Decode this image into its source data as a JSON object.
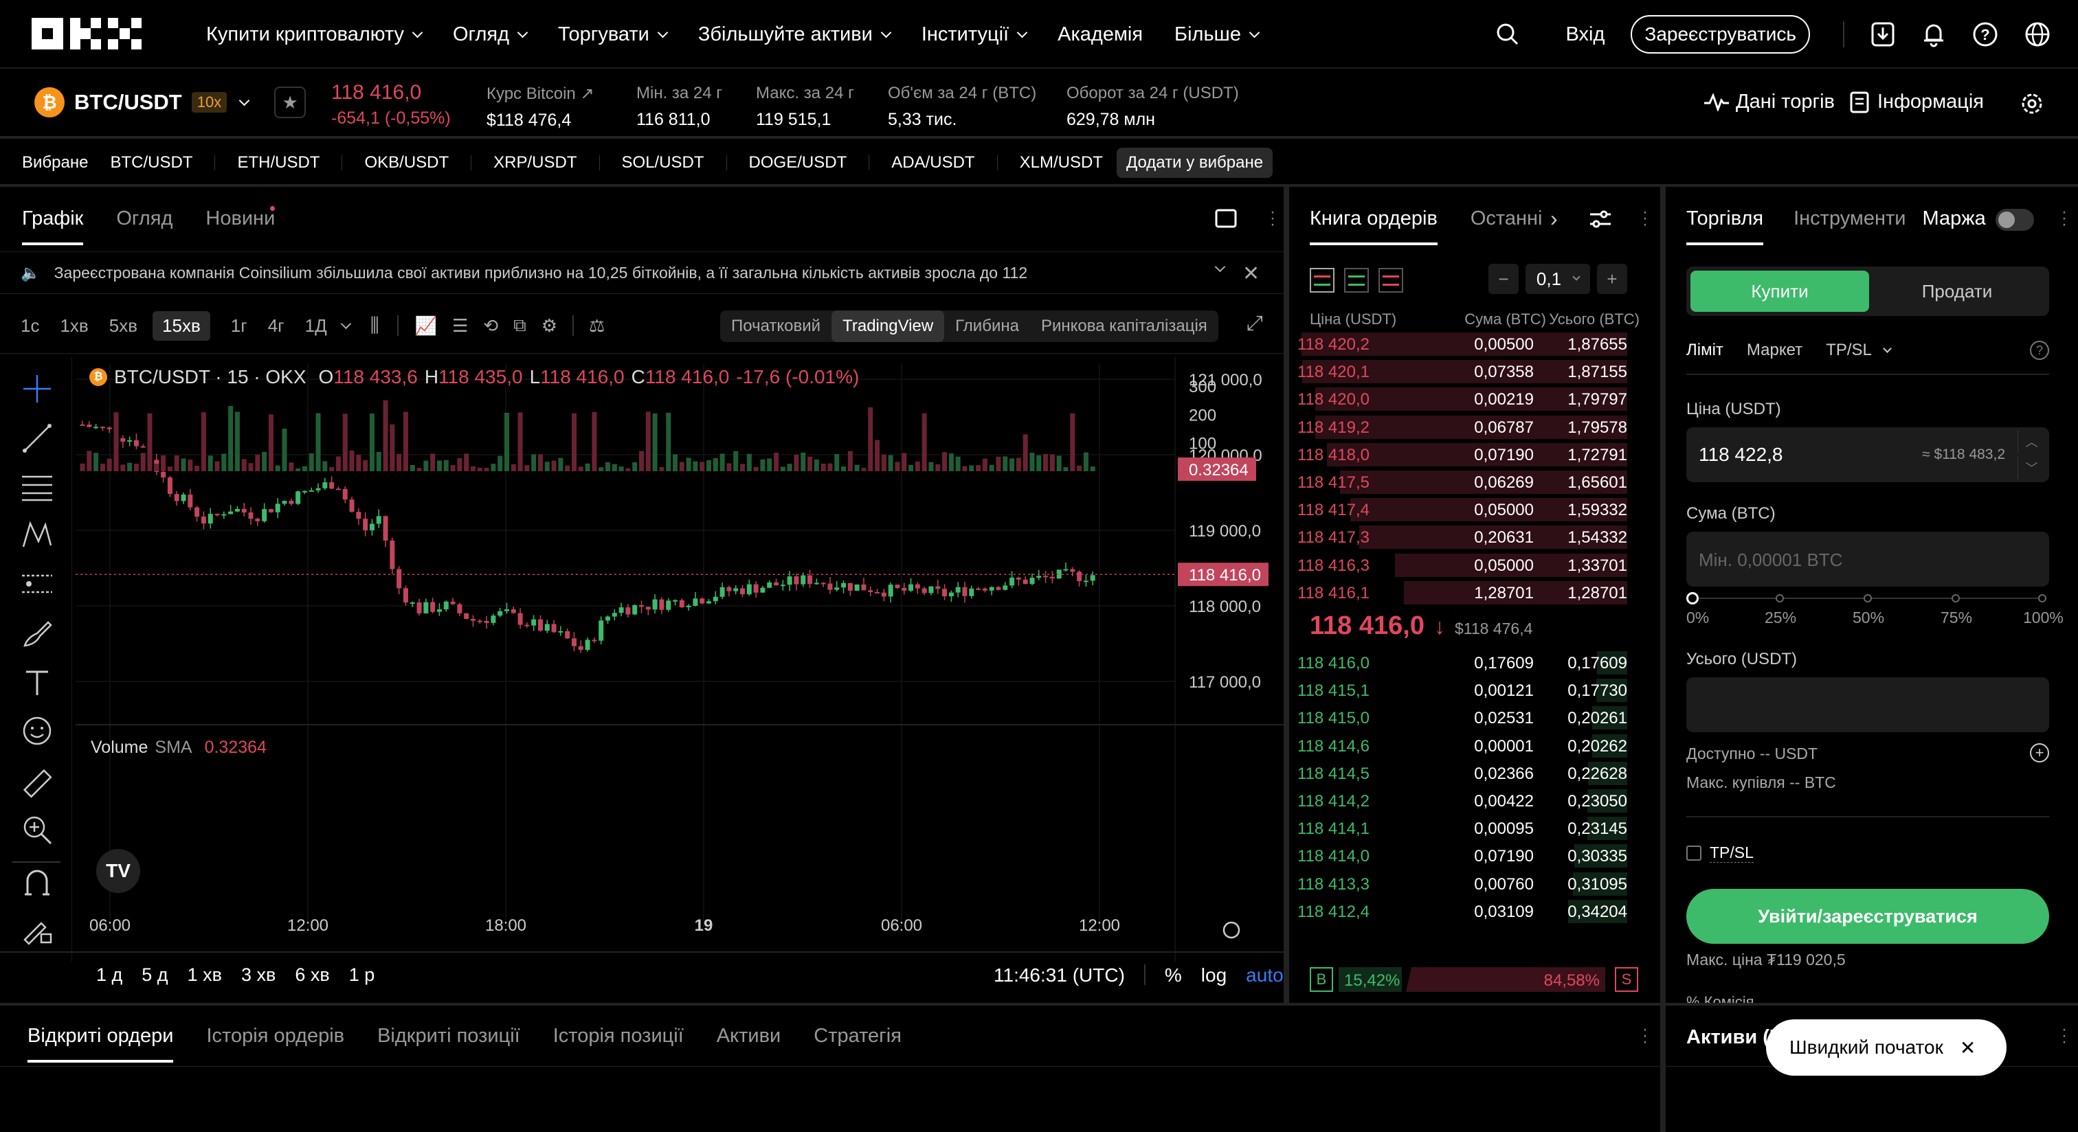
{
  "nav": {
    "logo": "OKX",
    "items": [
      "Купити криптовалюту",
      "Огляд",
      "Торгувати",
      "Збільшуйте активи",
      "Інституції",
      "Академія",
      "Більше"
    ],
    "login": "Вхід",
    "register": "Зареєструватись"
  },
  "ticker": {
    "pair": "BTC/USDT",
    "leverage": "10x",
    "last_price": "118 416,0",
    "change": "-654,1 (-0,55%)",
    "rate_label": "Курс Bitcoin",
    "rate_value": "$118 476,4",
    "low_label": "Мін. за 24 г",
    "low_value": "116 811,0",
    "high_label": "Макс. за 24 г",
    "high_value": "119 515,1",
    "vol_label": "Об'єм за 24 г (BTC)",
    "vol_value": "5,33 тис.",
    "turnover_label": "Оборот за 24 г (USDT)",
    "turnover_value": "629,78 млн",
    "trade_data": "Дані торгів",
    "info": "Інформація"
  },
  "favorites": {
    "label": "Вибране",
    "pairs": [
      "BTC/USDT",
      "ETH/USDT",
      "OKB/USDT",
      "XRP/USDT",
      "SOL/USDT",
      "DOGE/USDT",
      "ADA/USDT",
      "XLM/USDT"
    ],
    "add": "Додати у вибране"
  },
  "chart_tabs": [
    "Графік",
    "Огляд",
    "Новини"
  ],
  "news_text": "Зареєстрована компанія Coinsilium збільшила свої активи приблизно на 10,25 біткойнів, а її загальна кількість активів зросла до 112",
  "timeframes": [
    "1с",
    "1хв",
    "5хв",
    "15хв",
    "1г",
    "4г",
    "1Д"
  ],
  "chart_modes": [
    "Початковий",
    "TradingView",
    "Глибина",
    "Ринкова капіталізація"
  ],
  "ohlc": {
    "symbol": "BTC/USDT · 15 · OKX",
    "o": "118 433,6",
    "h": "118 435,0",
    "l": "118 416,0",
    "c": "118 416,0",
    "chg": "-17,6 (-0.01%)"
  },
  "price_axis": [
    "121 000,0",
    "120 000,0",
    "119 000,0",
    "118 000,0",
    "117 000,0"
  ],
  "current_price_tag": "118 416,0",
  "volume_label": "Volume",
  "volume_sma_label": "SMA",
  "volume_sma": "0.32364",
  "volume_axis": [
    "300",
    "200",
    "100"
  ],
  "time_axis": [
    "06:00",
    "12:00",
    "18:00",
    "19",
    "06:00",
    "12:00"
  ],
  "range_buttons": [
    "1 д",
    "5 д",
    "1 хв",
    "3 хв",
    "6 хв",
    "1 р"
  ],
  "clock": "11:46:31 (UTC)",
  "scale_opts": [
    "%",
    "log",
    "auto"
  ],
  "orderbook": {
    "tab1": "Книга ордерів",
    "tab2": "Останні",
    "step": "0,1",
    "headers": [
      "Ціна (USDT)",
      "Сума (BTC)",
      "Усього (BTC)"
    ],
    "asks": [
      [
        "118 420,2",
        "0,00500",
        "1,87655"
      ],
      [
        "118 420,1",
        "0,07358",
        "1,87155"
      ],
      [
        "118 420,0",
        "0,00219",
        "1,79797"
      ],
      [
        "118 419,2",
        "0,06787",
        "1,79578"
      ],
      [
        "118 418,0",
        "0,07190",
        "1,72791"
      ],
      [
        "118 417,5",
        "0,06269",
        "1,65601"
      ],
      [
        "118 417,4",
        "0,05000",
        "1,59332"
      ],
      [
        "118 417,3",
        "0,20631",
        "1,54332"
      ],
      [
        "118 416,3",
        "0,05000",
        "1,33701"
      ],
      [
        "118 416,1",
        "1,28701",
        "1,28701"
      ]
    ],
    "mid_price": "118 416,0",
    "mid_usd": "$118 476,4",
    "bids": [
      [
        "118 416,0",
        "0,17609",
        "0,17609"
      ],
      [
        "118 415,1",
        "0,00121",
        "0,17730"
      ],
      [
        "118 415,0",
        "0,02531",
        "0,20261"
      ],
      [
        "118 414,6",
        "0,00001",
        "0,20262"
      ],
      [
        "118 414,5",
        "0,02366",
        "0,22628"
      ],
      [
        "118 414,2",
        "0,00422",
        "0,23050"
      ],
      [
        "118 414,1",
        "0,00095",
        "0,23145"
      ],
      [
        "118 414,0",
        "0,07190",
        "0,30335"
      ],
      [
        "118 413,3",
        "0,00760",
        "0,31095"
      ],
      [
        "118 412,4",
        "0,03109",
        "0,34204"
      ]
    ],
    "buy_label": "B",
    "buy_pct": "15,42%",
    "sell_pct": "84,58%",
    "sell_label": "S"
  },
  "trade": {
    "tabs": [
      "Торгівля",
      "Інструменти",
      "Маржа"
    ],
    "buy": "Купити",
    "sell": "Продати",
    "order_types": [
      "Ліміт",
      "Маркет",
      "TP/SL"
    ],
    "price_label": "Ціна (USDT)",
    "price_value": "118 422,8",
    "price_usd": "≈ $118 483,2",
    "amount_label": "Сума (BTC)",
    "amount_placeholder": "Мін. 0,00001 BTC",
    "slider_marks": [
      "0%",
      "25%",
      "50%",
      "75%",
      "100%"
    ],
    "total_label": "Усього (USDT)",
    "available": "Доступно -- USDT",
    "max_buy": "Макс. купівля -- BTC",
    "tpsl": "TP/SL",
    "submit": "Увійти/зареєструватися",
    "max_price": "Макс. ціна ₮119 020,5",
    "fee": "% Комісія"
  },
  "bottom": {
    "tabs": [
      "Відкриті ордери",
      "Історія ордерів",
      "Відкриті позиції",
      "Історія позиції",
      "Активи",
      "Стратегія"
    ],
    "assets_title": "Активи (U"
  },
  "toast": "Швидкий початок",
  "colors": {
    "up": "#3dbb6a",
    "down": "#e0475e",
    "bg": "#000000"
  }
}
